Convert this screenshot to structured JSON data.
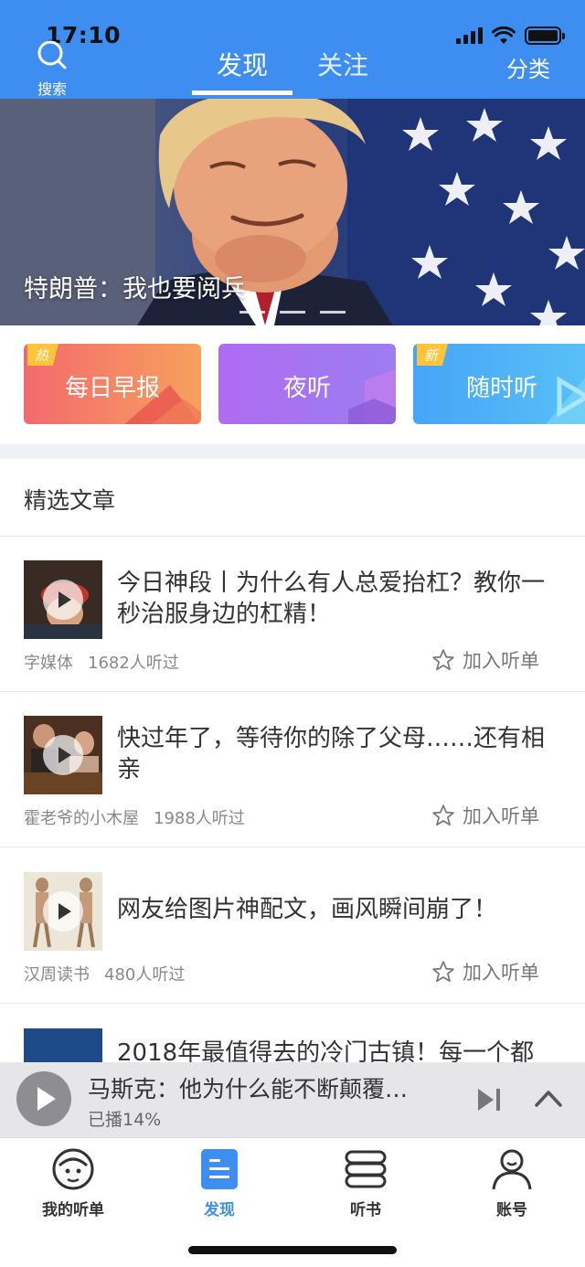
{
  "status_bar": {
    "time": "17:10"
  },
  "header": {
    "search_label": "搜索",
    "tabs": [
      {
        "label": "发现",
        "active": true
      },
      {
        "label": "关注",
        "active": false
      }
    ],
    "category_label": "分类",
    "accent": "#3d8ef0"
  },
  "banner": {
    "caption": "特朗普：我也要阅兵",
    "slide_count": 3
  },
  "quick_cards": [
    {
      "label": "每日早报",
      "tag": "热"
    },
    {
      "label": "夜听",
      "tag": ""
    },
    {
      "label": "随时听",
      "tag": "新"
    }
  ],
  "section": {
    "title": "精选文章"
  },
  "articles": [
    {
      "title": "今日神段丨为什么有人总爱抬杠？教你一秒治服身边的杠精！",
      "source": "字媒体",
      "listens": "1682人听过",
      "add_label": "加入听单"
    },
    {
      "title": "快过年了，等待你的除了父母……还有相亲",
      "source": "霍老爷的小木屋",
      "listens": "1988人听过",
      "add_label": "加入听单"
    },
    {
      "title": "网友给图片神配文，画风瞬间崩了！",
      "source": "汉周读书",
      "listens": "480人听过",
      "add_label": "加入听单"
    },
    {
      "title": "2018年最值得去的冷门古镇！每一个都"
    }
  ],
  "player": {
    "title": "马斯克：他为什么能不断颠覆…",
    "progress_text": "已播14%",
    "progress": 0.14
  },
  "bottom_nav": [
    {
      "label": "我的听单",
      "icon": "face-icon",
      "active": false
    },
    {
      "label": "发现",
      "icon": "list-doc-icon",
      "active": true
    },
    {
      "label": "听书",
      "icon": "books-icon",
      "active": false
    },
    {
      "label": "账号",
      "icon": "user-icon",
      "active": false
    }
  ]
}
